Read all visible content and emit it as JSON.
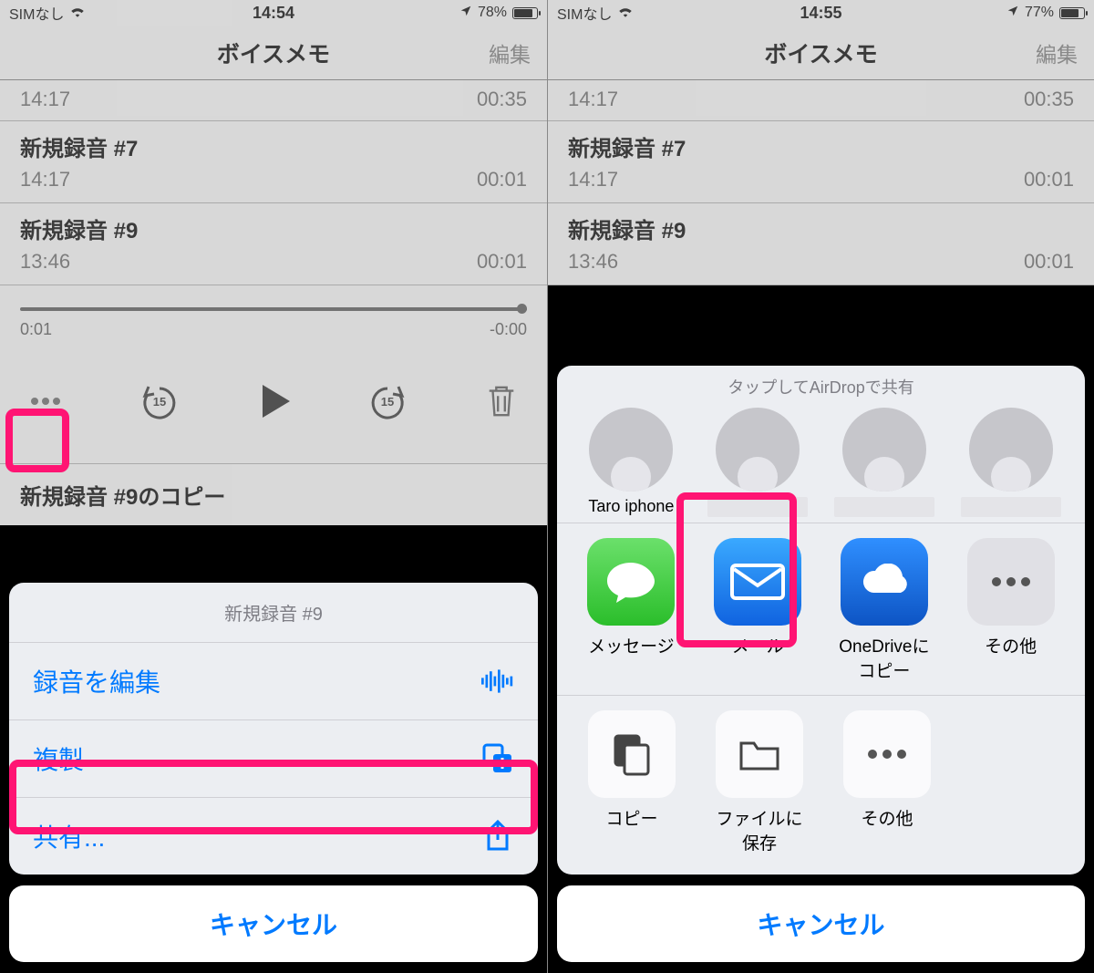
{
  "left": {
    "status": {
      "carrier": "SIMなし",
      "time": "14:54",
      "battery": "78%"
    },
    "header": {
      "title": "ボイスメモ",
      "edit": "編集"
    },
    "list": [
      {
        "name": "",
        "time": "14:17",
        "duration": "00:35"
      },
      {
        "name": "新規録音 #7",
        "time": "14:17",
        "duration": "00:01"
      },
      {
        "name": "新規録音 #9",
        "time": "13:46",
        "duration": "00:01"
      }
    ],
    "slider": {
      "start": "0:01",
      "end": "-0:00"
    },
    "copy_row": "新規録音 #9のコピー",
    "sheet": {
      "title": "新規録音 #9",
      "items": [
        {
          "label": "録音を編集",
          "icon": "waveform"
        },
        {
          "label": "複製",
          "icon": "duplicate"
        },
        {
          "label": "共有...",
          "icon": "share"
        }
      ],
      "cancel": "キャンセル"
    }
  },
  "right": {
    "status": {
      "carrier": "SIMなし",
      "time": "14:55",
      "battery": "77%"
    },
    "header": {
      "title": "ボイスメモ",
      "edit": "編集"
    },
    "list": [
      {
        "name": "",
        "time": "14:17",
        "duration": "00:35"
      },
      {
        "name": "新規録音 #7",
        "time": "14:17",
        "duration": "00:01"
      },
      {
        "name": "新規録音 #9",
        "time": "13:46",
        "duration": "00:01"
      }
    ],
    "share": {
      "airdrop_title": "タップしてAirDropで共有",
      "airdrop": [
        {
          "label": "Taro iphone"
        },
        {
          "label": ""
        },
        {
          "label": ""
        },
        {
          "label": ""
        }
      ],
      "apps": [
        {
          "label": "メッセージ",
          "icon": "messages"
        },
        {
          "label": "メール",
          "icon": "mail"
        },
        {
          "label": "OneDriveに\nコピー",
          "icon": "onedrive"
        },
        {
          "label": "その他",
          "icon": "more"
        }
      ],
      "actions": [
        {
          "label": "コピー",
          "icon": "copy"
        },
        {
          "label": "ファイルに\n保存",
          "icon": "folder"
        },
        {
          "label": "その他",
          "icon": "more"
        }
      ],
      "cancel": "キャンセル"
    }
  }
}
